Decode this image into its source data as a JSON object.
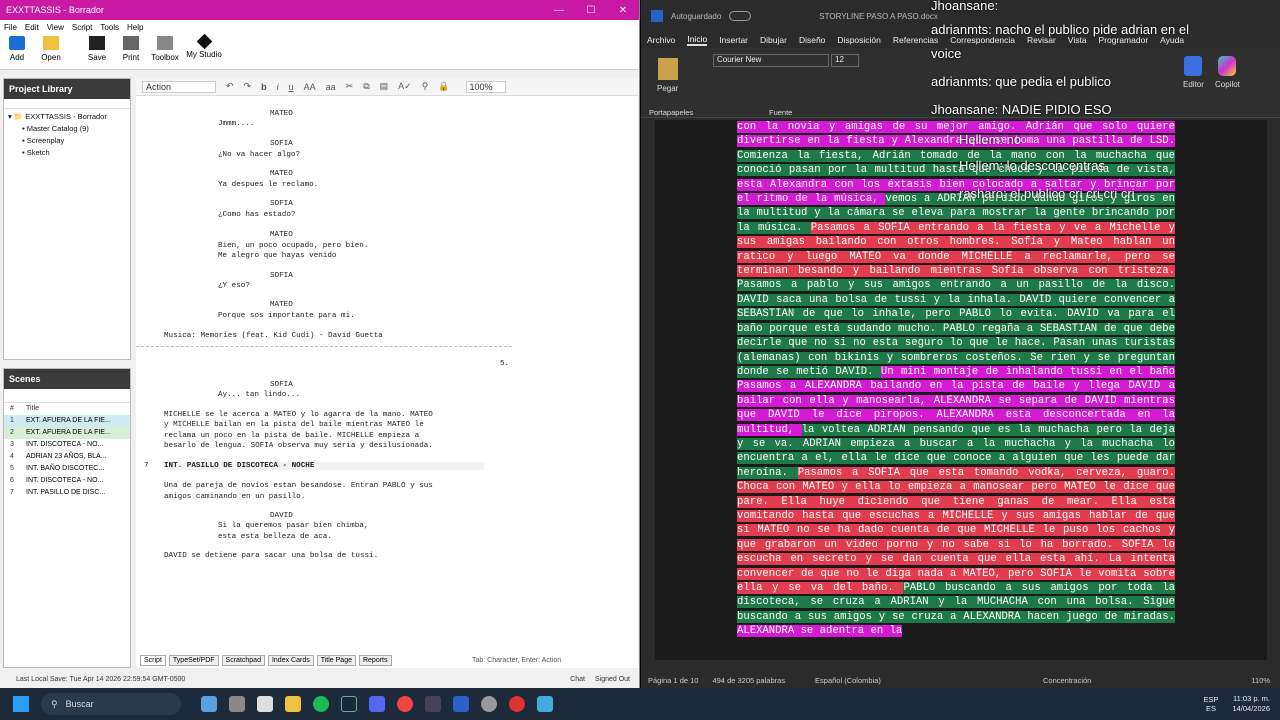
{
  "left_window": {
    "title": "EXXTTASSIS - Borrador",
    "window_controls": [
      "—",
      "☐",
      "✕"
    ],
    "menu": [
      "File",
      "Edit",
      "View",
      "Script",
      "Tools",
      "Help"
    ],
    "toolbar": [
      {
        "label": "Add",
        "icon": "star-icon"
      },
      {
        "label": "Open",
        "icon": "folder-icon"
      },
      {
        "label": "Save",
        "icon": "save-icon"
      },
      {
        "label": "Print",
        "icon": "print-icon"
      },
      {
        "label": "Toolbox",
        "icon": "toolbox-icon"
      },
      {
        "label": "My Studio",
        "icon": "studio-icon"
      }
    ],
    "project_library": {
      "title": "Project Library",
      "root": "EXXTTASSIS - Borrador",
      "items": [
        "Master Catalog (9)",
        "Screenplay",
        "Sketch"
      ]
    },
    "scenes": {
      "title": "Scenes",
      "col_num": "#",
      "col_title": "Title",
      "rows": [
        {
          "n": "1",
          "t": "EXT. AFUERA DE LA FIE..."
        },
        {
          "n": "2",
          "t": "EXT. AFUERA DE LA FIE..."
        },
        {
          "n": "3",
          "t": "INT. DISCOTECA - NO..."
        },
        {
          "n": "4",
          "t": "ADRIAN 23 AÑOS, BLA..."
        },
        {
          "n": "5",
          "t": "INT. BAÑO DISCOTEC..."
        },
        {
          "n": "6",
          "t": "INT. DISCOTECA - NO..."
        },
        {
          "n": "7",
          "t": "INT. PASILLO DE DISC..."
        }
      ]
    },
    "editor": {
      "element_type": "Action",
      "zoom": "100%",
      "page_number": "5.",
      "scene_number": "7",
      "lines": [
        "MATEO",
        "Jmmm....",
        "SOFIA",
        "¿No va hacer algo?",
        "MATEO",
        "Ya despues le reclamo.",
        "SOFIA",
        "¿Como has estado?",
        "MATEO",
        "Bien, un poco ocupado, pero bien.",
        "Me alegro que hayas venido",
        "SOFIA",
        "¿Y eso?",
        "MATEO",
        "Porque sos importante para mi.",
        "Musica: Memories (feat. Kid Cudi) - David Guetta",
        "SOFIA",
        "Ay... tan lindo...",
        "MICHELLE se le acerca a MATEO y lo agarra de la mano. MATEO",
        "y MICHELLE bailan en la pista del baile mientras MATEO le",
        "reclama un poco en la pista de baile. MICHELLE empieza a",
        "besarlo de lengua. SOFIA observa muy seria y desilusionada.",
        "INT. PASILLO DE DISCOTECA - NOCHE",
        "Una de pareja de novios estan besandose. Entran PABLO y sus",
        "amigos caminando en un pasillo.",
        "DAVID",
        "Si la queremos pasar bien chimba,",
        "esta esta belleza de aca.",
        "DAVID se detiene para sacar una bolsa de tussi."
      ],
      "tabs": [
        "Script",
        "TypeSet/PDF",
        "Scratchpad",
        "Index Cards",
        "Title Page",
        "Reports"
      ],
      "hint": "Tab: Character, Enter: Action",
      "chat": "Chat",
      "signed": "Signed Out"
    },
    "status": "Last Local Save: Tue Apr 14 2026 22:59:54 GMT-0500"
  },
  "right_window": {
    "autosave": "Autoguardado",
    "doc_title": "STORYLINE PASO A PASO.docx",
    "tabs": [
      "Archivo",
      "Inicio",
      "Insertar",
      "Dibujar",
      "Diseño",
      "Disposición",
      "Referencias",
      "Correspondencia",
      "Revisar",
      "Vista",
      "Programador",
      "Ayuda"
    ],
    "font": "Courier New",
    "font_size": "12",
    "paste": "Pegar",
    "clipboard": "Portapapeles",
    "font_group": "Fuente",
    "editor": "Editor",
    "copilot": "Copilot",
    "status": {
      "page": "Página 1 de 10",
      "words": "494 de 3205 palabras",
      "lang": "Español (Colombia)",
      "focus": "Concentración",
      "zoom": "110%"
    },
    "overlay": [
      {
        "t": "Jhoansane:"
      },
      {
        "t": "adrianmts: nacho el publico pide adrian en el"
      },
      {
        "t": "voice"
      },
      {
        "t": "adrianmts: que pedia el publico"
      },
      {
        "t": "Jhoansane: NADIE PIDIO ESO"
      },
      {
        "t": "Hellem: no"
      },
      {
        "t": "Hellem: lo desconcentras"
      },
      {
        "t": "rasharo: el publico cri cri cri cri"
      }
    ],
    "doc_text": [
      {
        "c": "p",
        "t": "con la novia y amigas de su mejor amigo. Adrián que solo quiere divertirse en la fiesta y Alexandra que se toma una pastilla de LSD. "
      },
      {
        "c": "g",
        "t": "Comienza la fiesta, Adrián tomado de la mano con la muchacha que conoció pasan por la multitud hasta que choca y la pierda de vista, "
      },
      {
        "c": "p",
        "t": "esta Alexandra con los éxtasis bien colocado a saltar y brincar por el ritmo de la música, "
      },
      {
        "c": "g",
        "t": "vemos a ADRIAN perdido dando giros y giros en la multitud y la cámara se eleva para mostrar la gente brincando por la música. "
      },
      {
        "c": "r",
        "t": "Pasamos a SOFIA entrando a la fiesta y ve a Michelle y sus amigas bailando con otros hombres. Sofía y Mateo hablan un ratico y luego MATEO va donde MICHELLE a reclamarle, pero se terminan besando y bailando mientras Sofía observa con tristeza. "
      },
      {
        "c": "g",
        "t": "Pasamos a pablo y sus amigos entrando a un pasillo de la disco. DAVID saca una bolsa de tussi y la inhala. DAVID quiere convencer a SEBASTIAN de que lo inhale, pero PABLO lo evita. DAVID va para el baño porque está sudando mucho. PABLO regaña a SEBASTIAN de que debe decirle que no si no esta seguro lo que le hace. Pasan unas turistas (alemanas) con bikinis y sombreros costeños. Se rien y se preguntan donde se metió DAVID. "
      },
      {
        "c": "p",
        "t": "Un mini montaje de inhalando tussi en el baño Pasamos a ALEXANDRA bailando en la pista de baile y llega DAVID a bailar con ella y manosearla, ALEXANDRA se separa de DAVID mientras que DAVID le dice piropos. ALEXANDRA esta desconcertada en la multitud, "
      },
      {
        "c": "g",
        "t": "la voltea ADRIAN pensando que es la muchacha pero la deja y se va. ADRIAN empieza a buscar a la muchacha y la muchacha lo encuentra a el, ella le dice que conoce a alguien que les puede dar heroína. "
      },
      {
        "c": "r",
        "t": "Pasamos a SOFIA que esta tomando vodka, cerveza, guaro. Choca con MATEO y ella lo empieza a manosear pero MATEO le dice que pare. Ella huye diciendo que tiene ganas de mear. Ella esta vomitando hasta que escuchas a MICHELLE y sus amigas hablar de que si MATEO no se ha dado cuenta de que MICHELLE le puso los cachos y que grabaron un video porno y no sabe si lo ha borrado. SOFIA lo escucha en secreto y se dan cuenta que ella esta ahí. La intenta convencer de que no le diga nada a MATEO, pero SOFIA le vomita sobre ella y se va del baño. "
      },
      {
        "c": "g",
        "t": "PABLO buscando a sus amigos por toda la discoteca, se cruza a ADRIAN y la MUCHACHA con una bolsa. Sigue buscando a sus amigos y se cruza a ALEXANDRA hacen juego de miradas. "
      },
      {
        "c": "p",
        "t": "ALEXANDRA se adentra en la"
      }
    ]
  },
  "taskbar": {
    "search": "Buscar",
    "lang1": "ESP",
    "lang2": "ES",
    "time": "11:03 p. m.",
    "date": "14/04/2026"
  }
}
